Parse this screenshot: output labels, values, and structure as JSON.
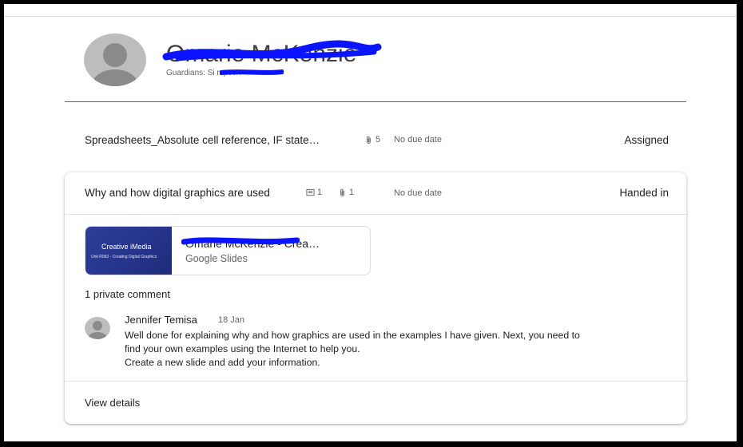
{
  "student": {
    "name": "Omarie McKenzie",
    "guardians": "Guardians: Si        mpson"
  },
  "assignments": [
    {
      "title": "Spreadsheets_Absolute cell reference, IF state…",
      "attachments_count": "5",
      "due": "No due date",
      "status": "Assigned"
    },
    {
      "title": "Why and how digital graphics are used",
      "comments_count": "1",
      "attachments_count": "1",
      "due": "No due date",
      "status": "Handed in",
      "attachment": {
        "thumbnail_title": "Creative iMedia",
        "thumbnail_subtitle": "Unit R082 - Creating Digital Graphics",
        "name": "Omarie McKenzie - Crea…",
        "type": "Google Slides"
      },
      "private_comments_label": "1 private comment",
      "comment": {
        "author": "Jennifer Temisa",
        "date": "18 Jan",
        "text": "Well done for explaining why and how graphics are used in the examples I have given.  Next, you need to\nfind your own  examples using the Internet to help you.\nCreate a new slide and add your information."
      },
      "view_details_label": "View details"
    }
  ],
  "icons": {
    "attachment": "paperclip-icon",
    "comment": "comment-icon",
    "avatar": "avatar-icon"
  },
  "colors": {
    "redaction": "#0a14ff",
    "thumbnail_bg": "#2b3a94"
  }
}
